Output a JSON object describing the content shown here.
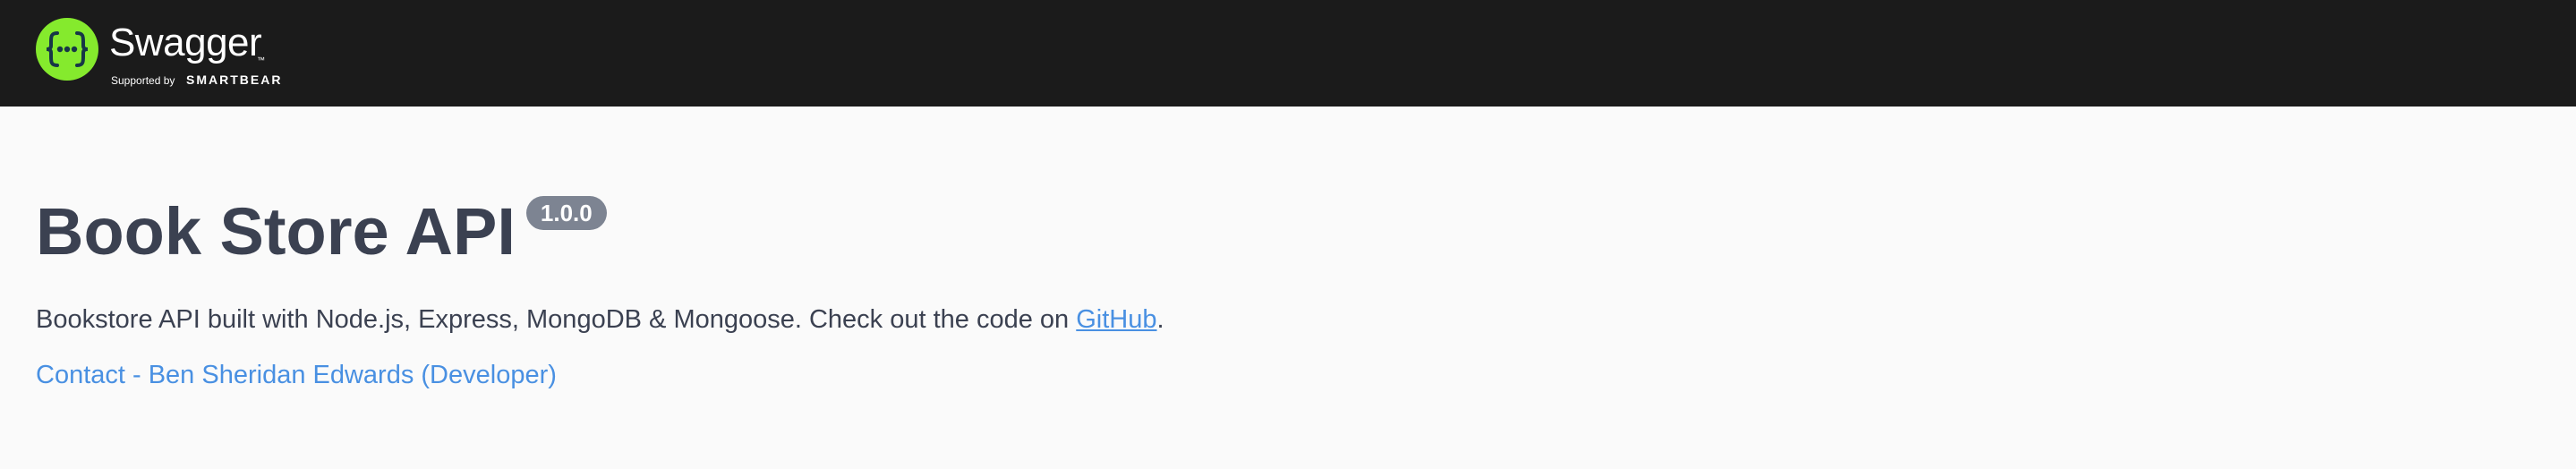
{
  "topbar": {
    "logo": {
      "icon": "swagger-braces-icon",
      "wordmark": "Swagger",
      "trademark": "™",
      "supported_by": "Supported by",
      "brand": "SMARTBEAR"
    }
  },
  "info": {
    "title": "Book Store API",
    "version": "1.0.0",
    "description_prefix": "Bookstore API built with Node.js, Express, MongoDB & Mongoose. Check out the code on ",
    "description_link": "GitHub",
    "description_suffix": ".",
    "contact": "Contact - Ben Sheridan Edwards (Developer)"
  },
  "colors": {
    "topbar_bg": "#1b1b1b",
    "logo_green": "#85ea2d",
    "page_bg": "#fafafa",
    "title_text": "#3b4151",
    "badge_bg": "#7d8492",
    "link": "#4990e2"
  }
}
